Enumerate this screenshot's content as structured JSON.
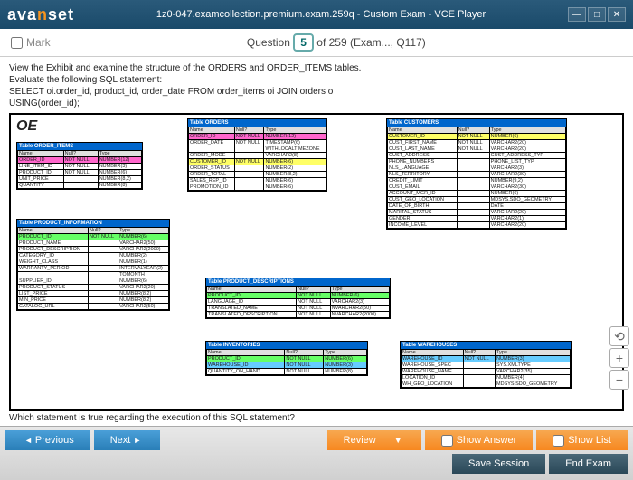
{
  "titlebar": {
    "logo_a": "ava",
    "logo_b": "n",
    "logo_c": "set",
    "title": "1z0-047.examcollection.premium.exam.259q - Custom Exam - VCE Player"
  },
  "qbar": {
    "mark": "Mark",
    "q_word": "Question",
    "q_num": "5",
    "q_rest": " of 259 (Exam..., Q117)"
  },
  "question": {
    "l1": "View the Exhibit and examine the structure of the ORDERS and ORDER_ITEMS tables.",
    "l2": "Evaluate the following SQL statement:",
    "l3": "SELECT oi.order_id, product_id, order_date FROM order_items oi JOIN orders o",
    "l4": "USING(order_id);",
    "cut": "Which statement is true regarding the execution of this SQL statement?"
  },
  "diagram": {
    "oe": "OE",
    "hdr_name": "Name",
    "hdr_null": "Null?",
    "hdr_type": "Type",
    "order_items": {
      "title": "Table ORDER_ITEMS",
      "rows": [
        [
          "ORDER_ID",
          "NOT NULL",
          "NUMBER(12)",
          "pk"
        ],
        [
          "LINE_ITEM_ID",
          "NOT NULL",
          "NUMBER(3)",
          ""
        ],
        [
          "PRODUCT_ID",
          "NOT NULL",
          "NUMBER(6)",
          ""
        ],
        [
          "UNIT_PRICE",
          "",
          "NUMBER(8,2)",
          ""
        ],
        [
          "QUANTITY",
          "",
          "NUMBER(8)",
          ""
        ]
      ]
    },
    "orders": {
      "title": "Table ORDERS",
      "rows": [
        [
          "ORDER_ID",
          "NOT NULL",
          "NUMBER(12)",
          "pk"
        ],
        [
          "ORDER_DATE",
          "NOT NULL",
          "TIMESTAMP(6)",
          ""
        ],
        [
          "",
          "",
          "WITHLOCALTIMEZONE",
          ""
        ],
        [
          "ORDER_MODE",
          "",
          "VARCHAR2(8)",
          ""
        ],
        [
          "CUSTOMER_ID",
          "NOT NULL",
          "NUMBER(6)",
          "nn"
        ],
        [
          "ORDER_STATUS",
          "",
          "NUMBER(2)",
          ""
        ],
        [
          "ORDER_TOTAL",
          "",
          "NUMBER(8,2)",
          ""
        ],
        [
          "SALES_REP_ID",
          "",
          "NUMBER(6)",
          ""
        ],
        [
          "PROMOTION_ID",
          "",
          "NUMBER(6)",
          ""
        ]
      ]
    },
    "customers": {
      "title": "Table CUSTOMERS",
      "rows": [
        [
          "CUSTOMER_ID",
          "NOT NULL",
          "NUMBER(6)",
          "nn"
        ],
        [
          "CUST_FIRST_NAME",
          "NOT NULL",
          "VARCHAR2(20)",
          ""
        ],
        [
          "CUST_LAST_NAME",
          "NOT NULL",
          "VARCHAR2(20)",
          ""
        ],
        [
          "CUST_ADDRESS",
          "",
          "CUST_ADDRESS_TYP",
          ""
        ],
        [
          "PHONE_NUMBERS",
          "",
          "PHONE_LIST_TYP",
          ""
        ],
        [
          "NLS_LANGUAGE",
          "",
          "VARCHAR2(3)",
          ""
        ],
        [
          "NLS_TERRITORY",
          "",
          "VARCHAR2(30)",
          ""
        ],
        [
          "CREDIT_LIMIT",
          "",
          "NUMBER(9,2)",
          ""
        ],
        [
          "CUST_EMAIL",
          "",
          "VARCHAR2(30)",
          ""
        ],
        [
          "ACCOUNT_MGR_ID",
          "",
          "NUMBER(6)",
          ""
        ],
        [
          "CUST_GEO_LOCATION",
          "",
          "MDSYS.SDO_GEOMETRY",
          ""
        ],
        [
          "DATE_OF_BIRTH",
          "",
          "DATE",
          ""
        ],
        [
          "MARITAL_STATUS",
          "",
          "VARCHAR2(20)",
          ""
        ],
        [
          "GENDER",
          "",
          "VARCHAR2(1)",
          ""
        ],
        [
          "INCOME_LEVEL",
          "",
          "VARCHAR2(20)",
          ""
        ]
      ]
    },
    "product_info": {
      "title": "Table PRODUCT_INFORMATION",
      "rows": [
        [
          "PRODUCT_ID",
          "NOT NULL",
          "NUMBER(6)",
          "fk1"
        ],
        [
          "PRODUCT_NAME",
          "",
          "VARCHAR2(50)",
          ""
        ],
        [
          "PRODUCT_DESCRIPTION",
          "",
          "VARCHAR2(2000)",
          ""
        ],
        [
          "CATEGORY_ID",
          "",
          "NUMBER(2)",
          ""
        ],
        [
          "WEIGHT_CLASS",
          "",
          "NUMBER(1)",
          ""
        ],
        [
          "WARRANTY_PERIOD",
          "",
          "INTERVALYEAR(2)",
          ""
        ],
        [
          "",
          "",
          "TOMONTH",
          ""
        ],
        [
          "SUPPLIER_ID",
          "",
          "NUMBER(6)",
          ""
        ],
        [
          "PRODUCT_STATUS",
          "",
          "VARCHAR2(20)",
          ""
        ],
        [
          "LIST_PRICE",
          "",
          "NUMBER(8,2)",
          ""
        ],
        [
          "MIN_PRICE",
          "",
          "NUMBER(8,2)",
          ""
        ],
        [
          "CATALOG_URL",
          "",
          "VARCHAR2(50)",
          ""
        ]
      ]
    },
    "product_desc": {
      "title": "Table PRODUCT_DESCRIPTIONS",
      "rows": [
        [
          "PRODUCT_ID",
          "NOT NULL",
          "NUMBER(6)",
          "fk1"
        ],
        [
          "LANGUAGE_ID",
          "NOT NULL",
          "VARCHAR2(3)",
          ""
        ],
        [
          "TRANSLATED_NAME",
          "NOT NULL",
          "NVARCHAR2(50)",
          ""
        ],
        [
          "TRANSLATED_DESCRIPTION",
          "NOT NULL",
          "NVARCHAR2(2000)",
          ""
        ]
      ]
    },
    "inventories": {
      "title": "Table INVENTORIES",
      "rows": [
        [
          "PRODUCT_ID",
          "NOT NULL",
          "NUMBER(6)",
          "fk1"
        ],
        [
          "WAREHOUSE_ID",
          "NOT NULL",
          "NUMBER(3)",
          "fk2"
        ],
        [
          "QUANTITY_ON_HAND",
          "NOT NULL",
          "NUMBER(8)",
          ""
        ]
      ]
    },
    "warehouses": {
      "title": "Table WAREHOUSES",
      "rows": [
        [
          "WAREHOUSE_ID",
          "NOT NULL",
          "NUMBER(3)",
          "fk2"
        ],
        [
          "WAREHOUSE_SPEC",
          "",
          "SYS.XMLTYPE",
          ""
        ],
        [
          "WAREHOUSE_NAME",
          "",
          "VARCHAR2(35)",
          ""
        ],
        [
          "LOCATION_ID",
          "",
          "NUMBER(4)",
          ""
        ],
        [
          "WH_GEO_LOCATION",
          "",
          "MDSYS.SDO_GEOMETRY",
          ""
        ]
      ]
    }
  },
  "footer": {
    "prev": "Previous",
    "next": "Next",
    "review": "Review",
    "show_answer": "Show Answer",
    "show_list": "Show List",
    "save": "Save Session",
    "end": "End Exam"
  }
}
